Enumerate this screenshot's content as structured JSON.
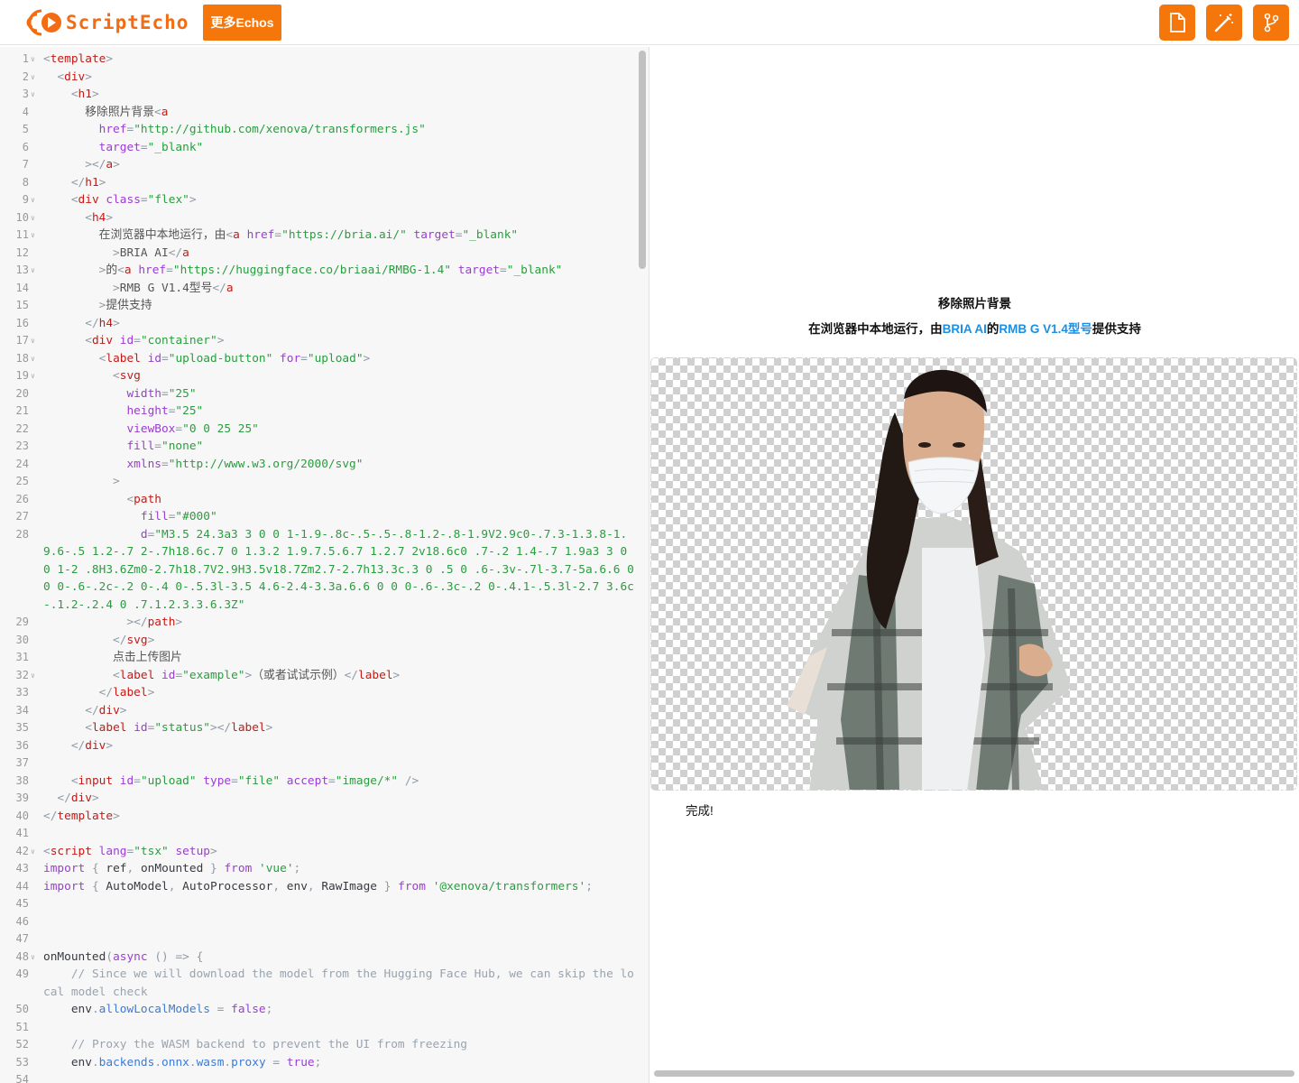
{
  "header": {
    "logo_text": "ScriptEcho",
    "more_button": "更多Echos",
    "tools": [
      "file-icon",
      "magic-wand-icon",
      "git-branch-icon"
    ],
    "accent_color": "#f5760a"
  },
  "editor": {
    "lines": [
      {
        "n": "1",
        "f": true,
        "h": "<span class=\"p\">&lt;</span><span class=\"t\">template</span><span class=\"p\">&gt;</span>"
      },
      {
        "n": "2",
        "f": true,
        "h": "  <span class=\"p\">&lt;</span><span class=\"t\">div</span><span class=\"p\">&gt;</span>"
      },
      {
        "n": "3",
        "f": true,
        "h": "    <span class=\"p\">&lt;</span><span class=\"t\">h1</span><span class=\"p\">&gt;</span>"
      },
      {
        "n": "4",
        "f": false,
        "h": "      <span class=\"x\">移除照片背景</span><span class=\"p\">&lt;</span><span class=\"t\">a</span>"
      },
      {
        "n": "5",
        "f": false,
        "h": "        <span class=\"a\">href</span><span class=\"p\">=</span><span class=\"s\">\"http://github.com/xenova/transformers.js\"</span>"
      },
      {
        "n": "6",
        "f": false,
        "h": "        <span class=\"a\">target</span><span class=\"p\">=</span><span class=\"s\">\"_blank\"</span>"
      },
      {
        "n": "7",
        "f": false,
        "h": "      <span class=\"p\">&gt;&lt;/</span><span class=\"t\">a</span><span class=\"p\">&gt;</span>"
      },
      {
        "n": "8",
        "f": false,
        "h": "    <span class=\"p\">&lt;/</span><span class=\"t\">h1</span><span class=\"p\">&gt;</span>"
      },
      {
        "n": "9",
        "f": true,
        "h": "    <span class=\"p\">&lt;</span><span class=\"t\">div</span> <span class=\"a\">class</span><span class=\"p\">=</span><span class=\"s\">\"flex\"</span><span class=\"p\">&gt;</span>"
      },
      {
        "n": "10",
        "f": true,
        "h": "      <span class=\"p\">&lt;</span><span class=\"t\">h4</span><span class=\"p\">&gt;</span>"
      },
      {
        "n": "11",
        "f": true,
        "h": "        <span class=\"x\">在浏览器中本地运行，由</span><span class=\"p\">&lt;</span><span class=\"t\">a</span> <span class=\"a\">href</span><span class=\"p\">=</span><span class=\"s\">\"https://bria.ai/\"</span> <span class=\"a\">target</span><span class=\"p\">=</span><span class=\"s\">\"_blank\"</span>"
      },
      {
        "n": "12",
        "f": false,
        "h": "          <span class=\"p\">&gt;</span><span class=\"x\">BRIA AI</span><span class=\"p\">&lt;/</span><span class=\"t\">a</span>"
      },
      {
        "n": "13",
        "f": true,
        "h": "        <span class=\"p\">&gt;</span><span class=\"x\">的</span><span class=\"p\">&lt;</span><span class=\"t\">a</span> <span class=\"a\">href</span><span class=\"p\">=</span><span class=\"s\">\"https://huggingface.co/briaai/RMBG-1.4\"</span> <span class=\"a\">target</span><span class=\"p\">=</span><span class=\"s\">\"_blank\"</span>"
      },
      {
        "n": "14",
        "f": false,
        "h": "          <span class=\"p\">&gt;</span><span class=\"x\">RMB G V1.4型号</span><span class=\"p\">&lt;/</span><span class=\"t\">a</span>"
      },
      {
        "n": "15",
        "f": false,
        "h": "        <span class=\"p\">&gt;</span><span class=\"x\">提供支持</span>"
      },
      {
        "n": "16",
        "f": false,
        "h": "      <span class=\"p\">&lt;/</span><span class=\"t\">h4</span><span class=\"p\">&gt;</span>"
      },
      {
        "n": "17",
        "f": true,
        "h": "      <span class=\"p\">&lt;</span><span class=\"t\">div</span> <span class=\"a\">id</span><span class=\"p\">=</span><span class=\"s\">\"container\"</span><span class=\"p\">&gt;</span>"
      },
      {
        "n": "18",
        "f": true,
        "h": "        <span class=\"p\">&lt;</span><span class=\"t\">label</span> <span class=\"a\">id</span><span class=\"p\">=</span><span class=\"s\">\"upload-button\"</span> <span class=\"a\">for</span><span class=\"p\">=</span><span class=\"s\">\"upload\"</span><span class=\"p\">&gt;</span>"
      },
      {
        "n": "19",
        "f": true,
        "h": "          <span class=\"p\">&lt;</span><span class=\"t\">svg</span>"
      },
      {
        "n": "20",
        "f": false,
        "h": "            <span class=\"a\">width</span><span class=\"p\">=</span><span class=\"s\">\"25\"</span>"
      },
      {
        "n": "21",
        "f": false,
        "h": "            <span class=\"a\">height</span><span class=\"p\">=</span><span class=\"s\">\"25\"</span>"
      },
      {
        "n": "22",
        "f": false,
        "h": "            <span class=\"a\">viewBox</span><span class=\"p\">=</span><span class=\"s\">\"0 0 25 25\"</span>"
      },
      {
        "n": "23",
        "f": false,
        "h": "            <span class=\"a\">fill</span><span class=\"p\">=</span><span class=\"s\">\"none\"</span>"
      },
      {
        "n": "24",
        "f": false,
        "h": "            <span class=\"a\">xmlns</span><span class=\"p\">=</span><span class=\"s\">\"http://www.w3.org/2000/svg\"</span>"
      },
      {
        "n": "25",
        "f": false,
        "h": "          <span class=\"p\">&gt;</span>"
      },
      {
        "n": "26",
        "f": false,
        "h": "            <span class=\"p\">&lt;</span><span class=\"t\">path</span>"
      },
      {
        "n": "27",
        "f": false,
        "h": "              <span class=\"a\">fill</span><span class=\"p\">=</span><span class=\"s\">\"#000\"</span>"
      },
      {
        "n": "28",
        "f": false,
        "h": "              <span class=\"a\">d</span><span class=\"p\">=</span><span class=\"s\">\"M3.5 24.3a3 3 0 0 1-1.9-.8c-.5-.5-.8-1.2-.8-1.9V2.9c0-.7.3-1.3.8-1.9.6-.5 1.2-.7 2-.7h18.6c.7 0 1.3.2 1.9.7.5.6.7 1.2.7 2v18.6c0 .7-.2 1.4-.7 1.9a3 3 0 0 1-2 .8H3.6Zm0-2.7h18.7V2.9H3.5v18.7Zm2.7-2.7h13.3c.3 0 .5 0 .6-.3v-.7l-3.7-5a.6.6 0 0 0-.6-.2c-.2 0-.4 0-.5.3l-3.5 4.6-2.4-3.3a.6.6 0 0 0-.6-.3c-.2 0-.4.1-.5.3l-2.7 3.6c-.1.2-.2.4 0 .7.1.2.3.3.6.3Z\"</span>"
      },
      {
        "n": "29",
        "f": false,
        "h": "            <span class=\"p\">&gt;&lt;/</span><span class=\"t\">path</span><span class=\"p\">&gt;</span>"
      },
      {
        "n": "30",
        "f": false,
        "h": "          <span class=\"p\">&lt;/</span><span class=\"t\">svg</span><span class=\"p\">&gt;</span>"
      },
      {
        "n": "31",
        "f": false,
        "h": "          <span class=\"x\">点击上传图片</span>"
      },
      {
        "n": "32",
        "f": true,
        "h": "          <span class=\"p\">&lt;</span><span class=\"t\">label</span> <span class=\"a\">id</span><span class=\"p\">=</span><span class=\"s\">\"example\"</span><span class=\"p\">&gt;</span><span class=\"x\">（或者试试示例）</span><span class=\"p\">&lt;/</span><span class=\"t\">label</span><span class=\"p\">&gt;</span>"
      },
      {
        "n": "33",
        "f": false,
        "h": "        <span class=\"p\">&lt;/</span><span class=\"t\">label</span><span class=\"p\">&gt;</span>"
      },
      {
        "n": "34",
        "f": false,
        "h": "      <span class=\"p\">&lt;/</span><span class=\"t\">div</span><span class=\"p\">&gt;</span>"
      },
      {
        "n": "35",
        "f": false,
        "h": "      <span class=\"p\">&lt;</span><span class=\"t\">label</span> <span class=\"a\">id</span><span class=\"p\">=</span><span class=\"s\">\"status\"</span><span class=\"p\">&gt;&lt;/</span><span class=\"t\">label</span><span class=\"p\">&gt;</span>"
      },
      {
        "n": "36",
        "f": false,
        "h": "    <span class=\"p\">&lt;/</span><span class=\"t\">div</span><span class=\"p\">&gt;</span>"
      },
      {
        "n": "37",
        "f": false,
        "h": ""
      },
      {
        "n": "38",
        "f": false,
        "h": "    <span class=\"p\">&lt;</span><span class=\"t\">input</span> <span class=\"a\">id</span><span class=\"p\">=</span><span class=\"s\">\"upload\"</span> <span class=\"a\">type</span><span class=\"p\">=</span><span class=\"s\">\"file\"</span> <span class=\"a\">accept</span><span class=\"p\">=</span><span class=\"s\">\"image/*\"</span> <span class=\"p\">/&gt;</span>"
      },
      {
        "n": "39",
        "f": false,
        "h": "  <span class=\"p\">&lt;/</span><span class=\"t\">div</span><span class=\"p\">&gt;</span>"
      },
      {
        "n": "40",
        "f": false,
        "h": "<span class=\"p\">&lt;/</span><span class=\"t\">template</span><span class=\"p\">&gt;</span>"
      },
      {
        "n": "41",
        "f": false,
        "h": ""
      },
      {
        "n": "42",
        "f": true,
        "h": "<span class=\"p\">&lt;</span><span class=\"t\">script</span> <span class=\"a\">lang</span><span class=\"p\">=</span><span class=\"s\">\"tsx\"</span> <span class=\"a\">setup</span><span class=\"p\">&gt;</span>"
      },
      {
        "n": "43",
        "f": false,
        "h": "<span class=\"k\">import</span> <span class=\"p\">{</span> <span class=\"v\">ref</span><span class=\"p\">,</span> <span class=\"v\">onMounted</span> <span class=\"p\">}</span> <span class=\"k\">from</span> <span class=\"m\">'vue'</span><span class=\"p\">;</span>"
      },
      {
        "n": "44",
        "f": false,
        "h": "<span class=\"k\">import</span> <span class=\"p\">{</span> <span class=\"v\">AutoModel</span><span class=\"p\">,</span> <span class=\"v\">AutoProcessor</span><span class=\"p\">,</span> <span class=\"v\">env</span><span class=\"p\">,</span> <span class=\"v\">RawImage</span> <span class=\"p\">}</span> <span class=\"k\">from</span> <span class=\"m\">'@xenova/transformers'</span><span class=\"p\">;</span>"
      },
      {
        "n": "45",
        "f": false,
        "h": ""
      },
      {
        "n": "46",
        "f": false,
        "h": ""
      },
      {
        "n": "47",
        "f": false,
        "h": ""
      },
      {
        "n": "48",
        "f": true,
        "h": "<span class=\"v\">onMounted</span><span class=\"p\">(</span><span class=\"k\">async</span> <span class=\"p\">()</span> <span class=\"p\">=&gt;</span> <span class=\"p\">{</span>"
      },
      {
        "n": "49",
        "f": false,
        "h": "    <span class=\"c\">// Since we will download the model from the Hugging Face Hub, we can skip the local model check</span>"
      },
      {
        "n": "50",
        "f": false,
        "h": "    <span class=\"v\">env</span><span class=\"p\">.</span><span class=\"pr\">allowLocalModels</span> <span class=\"p\">=</span> <span class=\"k\">false</span><span class=\"p\">;</span>"
      },
      {
        "n": "51",
        "f": false,
        "h": ""
      },
      {
        "n": "52",
        "f": false,
        "h": "    <span class=\"c\">// Proxy the WASM backend to prevent the UI from freezing</span>"
      },
      {
        "n": "53",
        "f": false,
        "h": "    <span class=\"v\">env</span><span class=\"p\">.</span><span class=\"pr\">backends</span><span class=\"p\">.</span><span class=\"pr\">onnx</span><span class=\"p\">.</span><span class=\"pr\">wasm</span><span class=\"p\">.</span><span class=\"pr\">proxy</span> <span class=\"p\">=</span> <span class=\"k\">true</span><span class=\"p\">;</span>"
      },
      {
        "n": "54",
        "f": false,
        "h": ""
      }
    ]
  },
  "preview": {
    "title": "移除照片背景",
    "sub_prefix": "在浏览器中本地运行，由",
    "sub_link1": "BRIA AI",
    "sub_mid": "的",
    "sub_link2": "RMB G V1.4型号",
    "sub_suffix": "提供支持",
    "status": "完成!",
    "image_alt": "woman-in-mask-cutout"
  }
}
